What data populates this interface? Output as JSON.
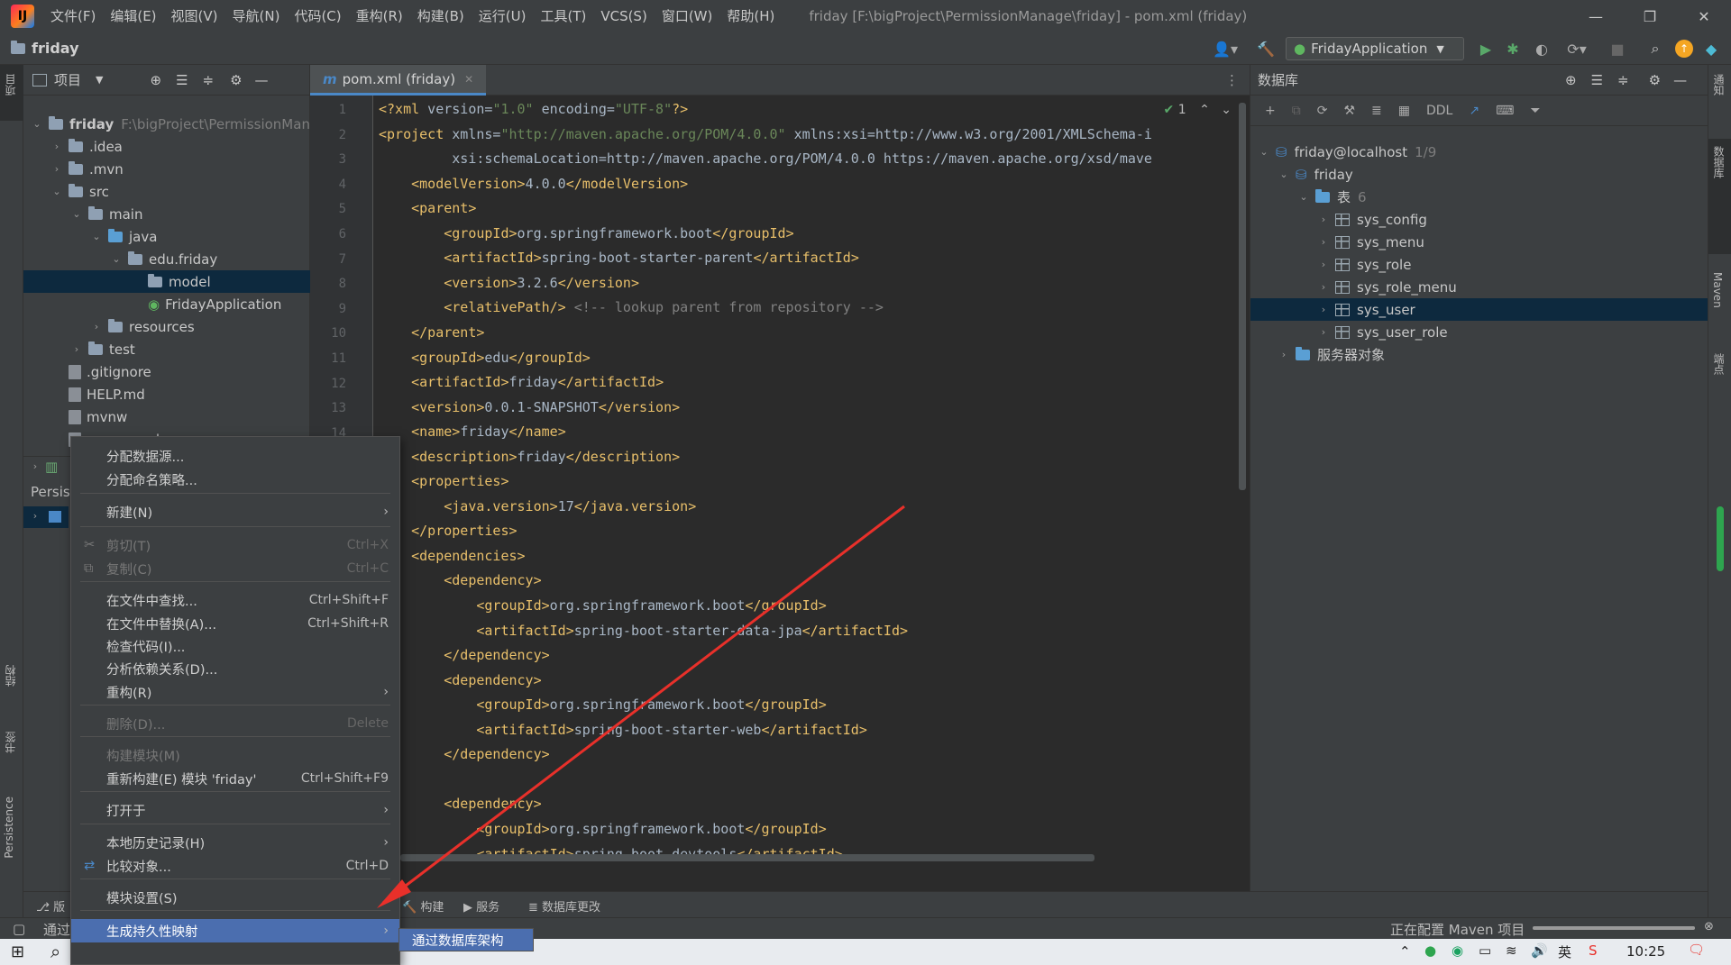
{
  "app": {
    "logo_text": "IJ"
  },
  "menubar": [
    "文件(F)",
    "编辑(E)",
    "视图(V)",
    "导航(N)",
    "代码(C)",
    "重构(R)",
    "构建(B)",
    "运行(U)",
    "工具(T)",
    "VCS(S)",
    "窗口(W)",
    "帮助(H)"
  ],
  "window_title": "friday [F:\\bigProject\\PermissionManage\\friday] - pom.xml (friday)",
  "nav": {
    "project": "friday",
    "run_config": "FridayApplication"
  },
  "project_panel": {
    "header": "项目",
    "tree": [
      {
        "label": "friday",
        "path": "F:\\bigProject\\PermissionMan"
      },
      {
        "label": ".idea"
      },
      {
        "label": ".mvn"
      },
      {
        "label": "src"
      },
      {
        "label": "main"
      },
      {
        "label": "java"
      },
      {
        "label": "edu.friday"
      },
      {
        "label": "model"
      },
      {
        "label": "FridayApplication"
      },
      {
        "label": "resources"
      },
      {
        "label": "test"
      },
      {
        "label": ".gitignore"
      },
      {
        "label": "HELP.md"
      },
      {
        "label": "mvnw"
      },
      {
        "label": "mvnw.cmd"
      }
    ],
    "persistence_label": "Persis"
  },
  "editor": {
    "tab": "pom.xml (friday)",
    "inspection_count": "1",
    "line_numbers": [
      "1",
      "2",
      "3",
      "4",
      "5",
      "6",
      "7",
      "8",
      "9",
      "10",
      "11",
      "12",
      "13",
      "14"
    ],
    "lines": [
      "<?xml version=\"1.0\" encoding=\"UTF-8\"?>",
      "<project xmlns=\"http://maven.apache.org/POM/4.0.0\" xmlns:xsi=\"http://www.w3.org/2001/XMLSchema-i",
      "         xsi:schemaLocation=\"http://maven.apache.org/POM/4.0.0 https://maven.apache.org/xsd/mave",
      "    <modelVersion>4.0.0</modelVersion>",
      "    <parent>",
      "        <groupId>org.springframework.boot</groupId>",
      "        <artifactId>spring-boot-starter-parent</artifactId>",
      "        <version>3.2.6</version>",
      "        <relativePath/> <!-- lookup parent from repository -->",
      "    </parent>",
      "    <groupId>edu</groupId>",
      "    <artifactId>friday</artifactId>",
      "    <version>0.0.1-SNAPSHOT</version>",
      "    <name>friday</name>",
      "    <description>friday</description>",
      "    <properties>",
      "        <java.version>17</java.version>",
      "    </properties>",
      "    <dependencies>",
      "        <dependency>",
      "            <groupId>org.springframework.boot</groupId>",
      "            <artifactId>spring-boot-starter-data-jpa</artifactId>",
      "        </dependency>",
      "        <dependency>",
      "            <groupId>org.springframework.boot</groupId>",
      "            <artifactId>spring-boot-starter-web</artifactId>",
      "        </dependency>",
      "",
      "        <dependency>",
      "            <groupId>org.springframework.boot</groupId>",
      "            <artifactId>spring-boot-devtools</artifactId>"
    ]
  },
  "db_panel": {
    "header": "数据库",
    "ddl": "DDL",
    "connection": "friday@localhost",
    "connection_count": "1/9",
    "schema": "friday",
    "tables_label": "表",
    "tables_count": "6",
    "tables": [
      "sys_config",
      "sys_menu",
      "sys_role",
      "sys_role_menu",
      "sys_user",
      "sys_user_role"
    ],
    "server_objects": "服务器对象"
  },
  "left_strip": {
    "project": "项目",
    "structure": "结构",
    "bookmarks": "书签",
    "persistence": "Persistence"
  },
  "right_strip": {
    "notifications": "通知",
    "database": "数据库",
    "maven": "Maven",
    "endpoints": "端点"
  },
  "tool_windows": [
    "构建",
    "服务",
    "数据库更改"
  ],
  "status": {
    "left": "通过",
    "task": "正在配置 Maven 项目",
    "version_label": "版"
  },
  "context_menu": {
    "items": [
      {
        "label": "分配数据源..."
      },
      {
        "label": "分配命名策略..."
      },
      {
        "label": "新建(N)",
        "submenu": "›"
      },
      {
        "label": "剪切(T)",
        "shortcut": "Ctrl+X"
      },
      {
        "label": "复制(C)",
        "shortcut": "Ctrl+C"
      },
      {
        "label": "在文件中查找...",
        "shortcut": "Ctrl+Shift+F"
      },
      {
        "label": "在文件中替换(A)...",
        "shortcut": "Ctrl+Shift+R"
      },
      {
        "label": "检查代码(I)..."
      },
      {
        "label": "分析依赖关系(D)..."
      },
      {
        "label": "重构(R)",
        "submenu": "›"
      },
      {
        "label": "删除(D)...",
        "shortcut": "Delete"
      },
      {
        "label": "构建模块(M)"
      },
      {
        "label": "重新构建(E) 模块 'friday'",
        "shortcut": "Ctrl+Shift+F9"
      },
      {
        "label": "打开于",
        "submenu": "›"
      },
      {
        "label": "本地历史记录(H)",
        "submenu": "›"
      },
      {
        "label": "比较对象...",
        "shortcut": "Ctrl+D"
      },
      {
        "label": "模块设置(S)"
      },
      {
        "label": "生成持久性映射",
        "submenu": "›"
      }
    ],
    "submenu_item": "通过数据库架构"
  },
  "taskbar": {
    "time": "10:25",
    "ime": "英"
  },
  "colors": {
    "accent": "#4b6eaf",
    "arrow": "#e8302a",
    "selection": "#0d293e"
  }
}
